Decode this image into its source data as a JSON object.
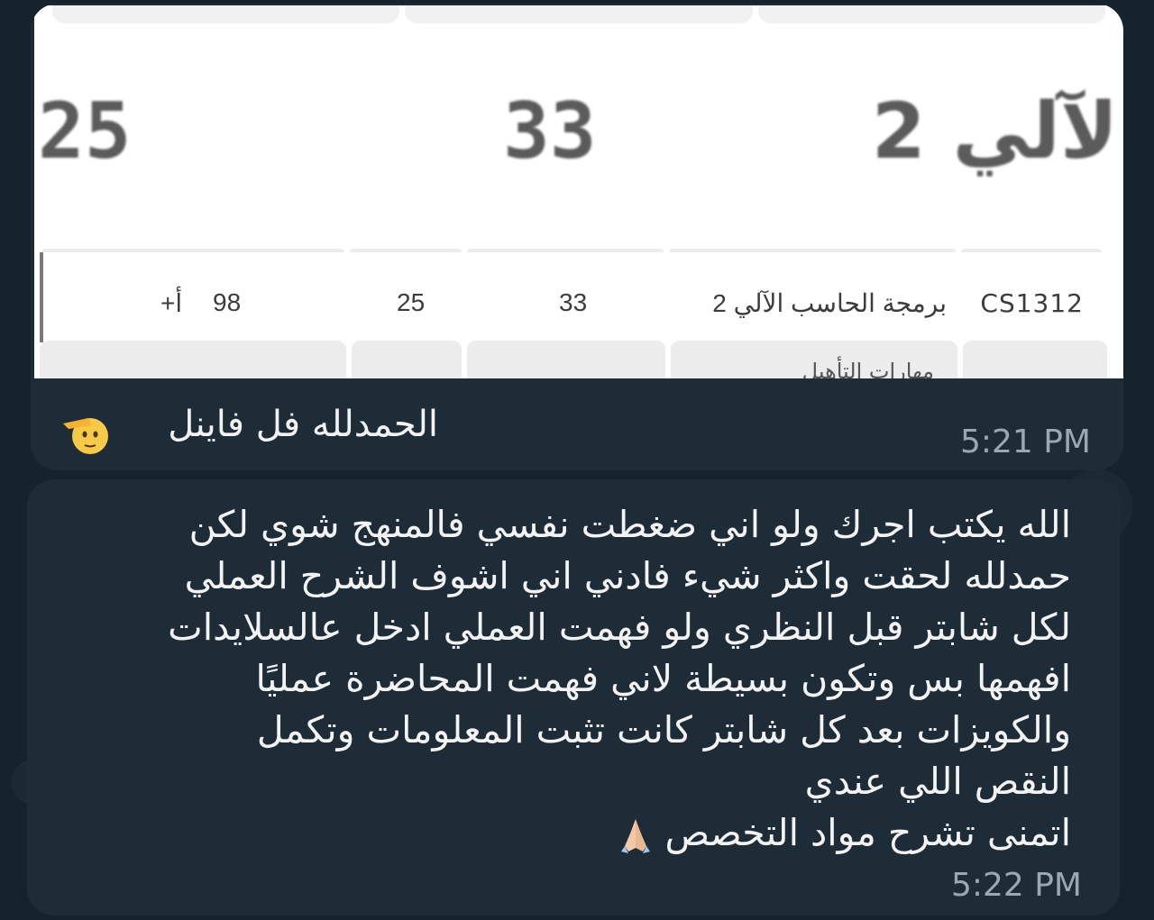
{
  "image": {
    "zoom": {
      "val1": "25",
      "val2": "33",
      "course": "لآلي 2"
    },
    "row": {
      "code": "CS1312",
      "name": "برمجة الحاسب الآلي 2",
      "col1": "33",
      "col2": "25",
      "col3": "98",
      "grade": "أ+"
    },
    "next_row_label": "مهارات التأهيل"
  },
  "messages": [
    {
      "text": "الحمدلله فل فاينل",
      "emoji": "saluting-face",
      "time": "5:21 PM"
    },
    {
      "lines": [
        "الله يكتب اجرك ولو اني ضغطت نفسي فالمنهج شوي لكن",
        "حمدلله لحقت واكثر شيء فادني اني اشوف الشرح العملي",
        "لكل شابتر قبل النظري ولو فهمت العملي ادخل عالسلايدات",
        "افهمها بس وتكون بسيطة لاني فهمت المحاضرة عمليًا",
        "والكويزات بعد كل شابتر كانت تثبت المعلومات وتكمل",
        "النقص اللي عندي",
        "اتمنى تشرح مواد التخصص"
      ],
      "emoji": "folded-hands",
      "time": "5:22 PM"
    }
  ],
  "colors": {
    "background": "#16222c",
    "bubble": "#1e2c38",
    "text": "#f3f3f3",
    "timestamp": "#9ba8b4"
  }
}
